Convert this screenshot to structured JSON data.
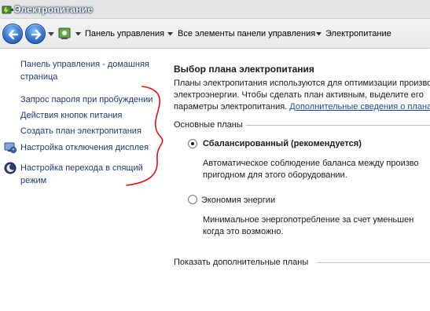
{
  "window": {
    "title": "Электропитание"
  },
  "addressbar": {
    "crumbs": [
      "Панель управления",
      "Все элементы панели управления",
      "Электропитание"
    ]
  },
  "sidebar": {
    "home_link": "Панель управления - домашняя страница",
    "links": [
      {
        "label": "Запрос пароля при пробуждении",
        "icon": null
      },
      {
        "label": "Действия кнопок питания",
        "icon": null
      },
      {
        "label": "Создать план электропитания",
        "icon": null
      },
      {
        "label": "Настройка отключения дисплея",
        "icon": "display-power-icon"
      },
      {
        "label": "Настройка перехода в спящий режим",
        "icon": "sleep-moon-icon"
      }
    ]
  },
  "main": {
    "title": "Выбор плана электропитания",
    "desc_line1": "Планы электропитания используются для оптимизации произво",
    "desc_line2": "электроэнергии. Чтобы сделать план активным, выделите его",
    "desc_line3_prefix": "параметры электропитания. ",
    "desc_link": "Дополнительные сведения о планах",
    "section_header": "Основные планы",
    "plans": [
      {
        "name": "Сбалансированный (рекомендуется)",
        "selected": true,
        "desc_line1": "Автоматическое соблюдение баланса между произво",
        "desc_line2": "пригодном для этого оборудовании."
      },
      {
        "name": "Экономия энергии",
        "selected": false,
        "desc_line1": "Минимальное энергопотребление за счет уменьшен",
        "desc_line2": "когда это возможно."
      }
    ],
    "more_plans": "Показать дополнительные планы"
  },
  "colors": {
    "link": "#1d3b73",
    "annotation": "#e01010"
  }
}
